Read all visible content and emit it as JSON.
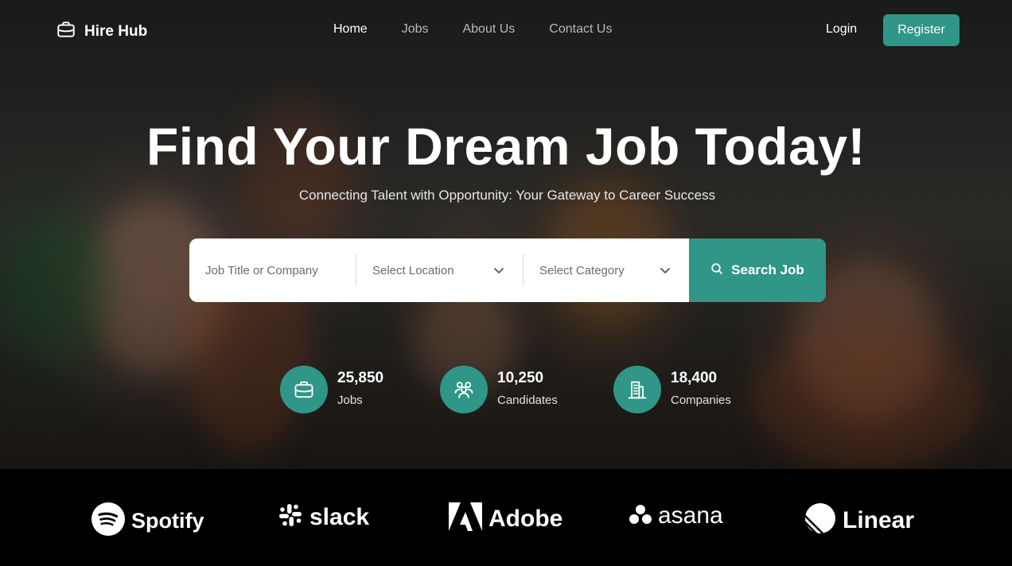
{
  "brand": {
    "name": "Hire Hub",
    "icon": "briefcase-icon"
  },
  "nav": {
    "links": [
      {
        "label": "Home",
        "active": true
      },
      {
        "label": "Jobs",
        "active": false
      },
      {
        "label": "About Us",
        "active": false
      },
      {
        "label": "Contact Us",
        "active": false
      }
    ],
    "login_label": "Login",
    "register_label": "Register"
  },
  "hero": {
    "title": "Find Your Dream Job Today!",
    "subtitle": "Connecting Talent with Opportunity: Your Gateway to Career Success"
  },
  "search": {
    "title_placeholder": "Job Title or Company",
    "location_placeholder": "Select Location",
    "category_placeholder": "Select Category",
    "button_label": "Search Job"
  },
  "stats": [
    {
      "value": "25,850",
      "label": "Jobs",
      "icon": "briefcase-icon"
    },
    {
      "value": "10,250",
      "label": "Candidates",
      "icon": "users-icon"
    },
    {
      "value": "18,400",
      "label": "Companies",
      "icon": "building-icon"
    }
  ],
  "partners": [
    {
      "name": "Spotify",
      "icon": "spotify-icon"
    },
    {
      "name": "slack",
      "icon": "slack-icon"
    },
    {
      "name": "Adobe",
      "icon": "adobe-icon"
    },
    {
      "name": "asana",
      "icon": "asana-icon"
    },
    {
      "name": "Linear",
      "icon": "linear-icon"
    }
  ],
  "colors": {
    "accent": "#2f9688",
    "background": "#000000"
  }
}
